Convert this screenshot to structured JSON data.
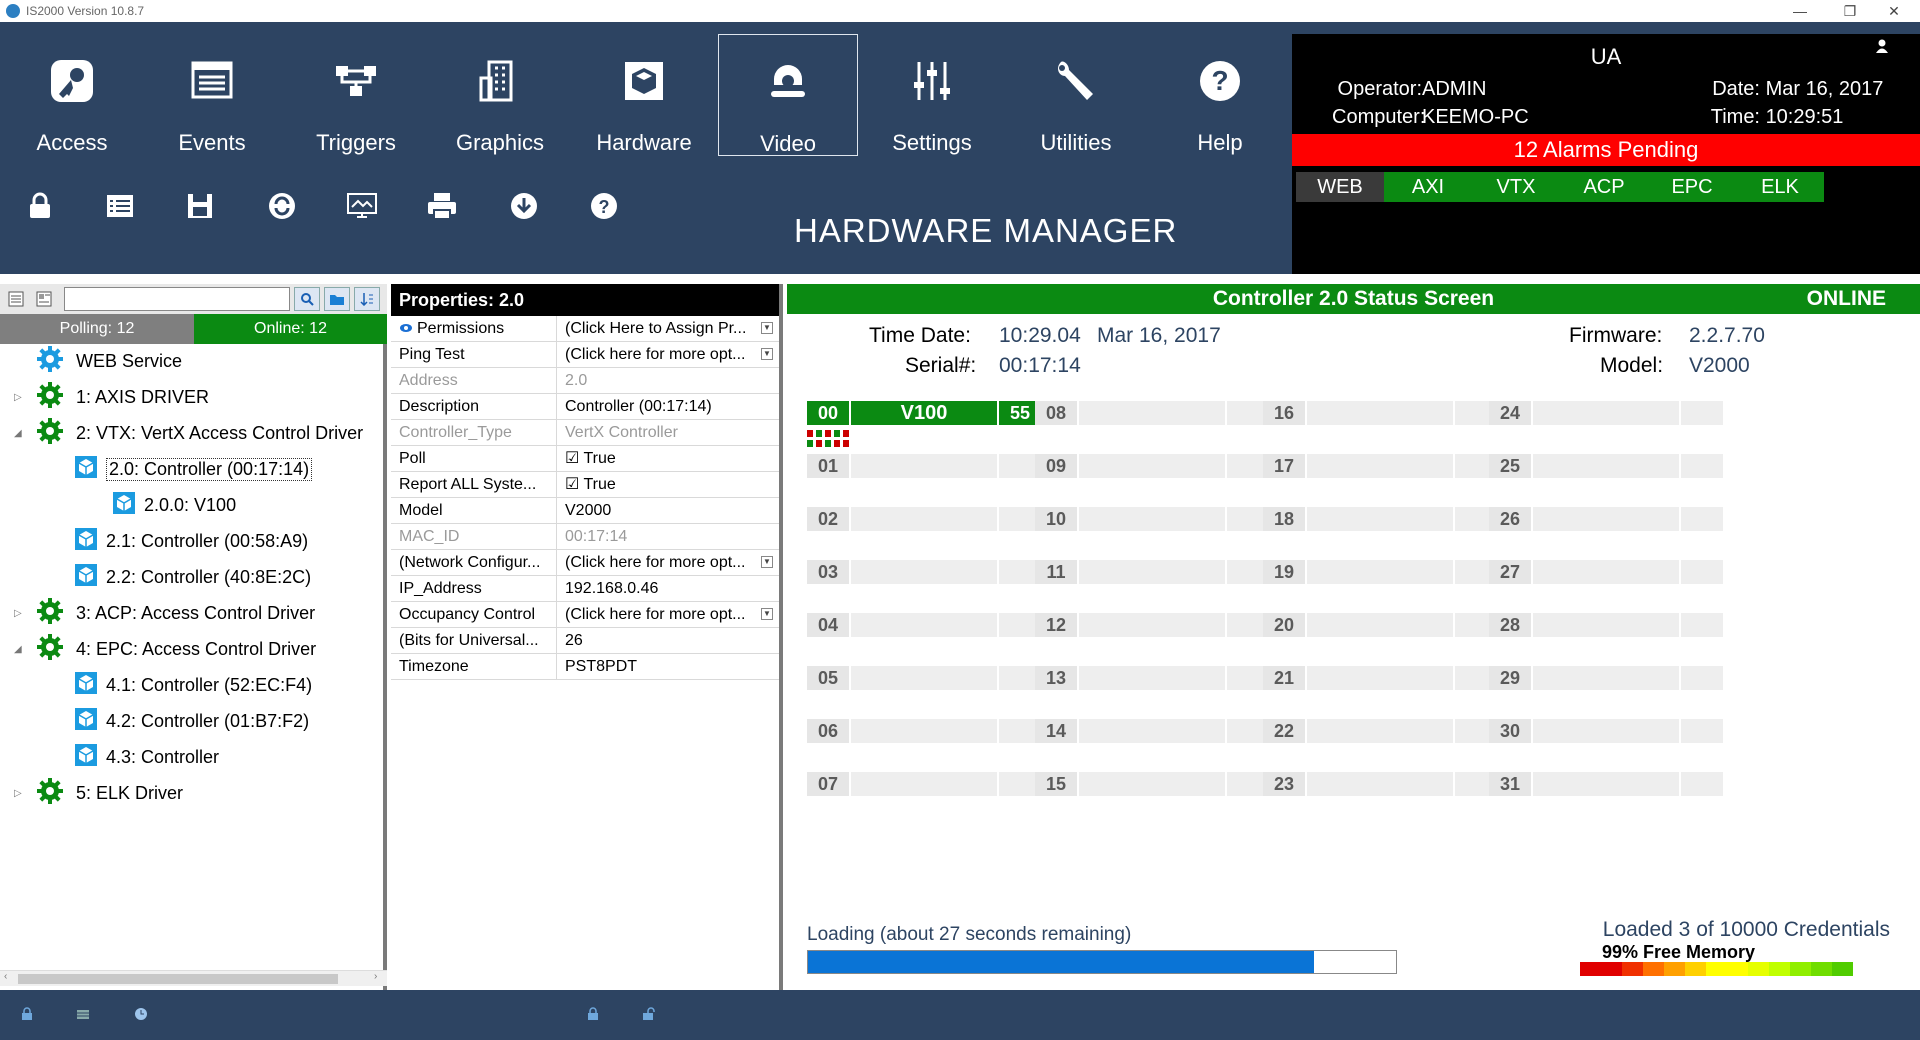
{
  "window": {
    "title": "IS2000 Version 10.8.7"
  },
  "nav": [
    {
      "label": "Access",
      "icon": "access-icon"
    },
    {
      "label": "Events",
      "icon": "events-icon"
    },
    {
      "label": "Triggers",
      "icon": "triggers-icon"
    },
    {
      "label": "Graphics",
      "icon": "graphics-icon"
    },
    {
      "label": "Hardware",
      "icon": "hardware-icon"
    },
    {
      "label": "Video",
      "icon": "video-icon",
      "active": true
    },
    {
      "label": "Settings",
      "icon": "settings-icon"
    },
    {
      "label": "Utilities",
      "icon": "utilities-icon"
    },
    {
      "label": "Help",
      "icon": "help-icon"
    }
  ],
  "toolbar": [
    "lock-icon",
    "list-icon",
    "save-icon",
    "refresh-icon",
    "monitor-icon",
    "print-icon",
    "download-icon",
    "help-icon"
  ],
  "page_title": "HARDWARE MANAGER",
  "status": {
    "ua": "UA",
    "operator_label": "Operator:",
    "operator": "ADMIN",
    "computer_label": "Computer:",
    "computer": "KEEMO-PC",
    "date_label": "Date:",
    "date": "Mar 16, 2017",
    "time_label": "Time:",
    "time": "10:29:51",
    "alarms": "12 Alarms Pending",
    "drivers": [
      {
        "name": "WEB",
        "color": "#3a3a3a"
      },
      {
        "name": "AXI",
        "color": "#0b8a12"
      },
      {
        "name": "VTX",
        "color": "#0b8a12"
      },
      {
        "name": "ACP",
        "color": "#0b8a12"
      },
      {
        "name": "EPC",
        "color": "#0b8a12"
      },
      {
        "name": "ELK",
        "color": "#0b8a12"
      }
    ]
  },
  "left": {
    "polling": "Polling:  12",
    "online": "Online:  12",
    "tree": [
      {
        "id": "web",
        "label": "WEB Service",
        "icon": "gear-blue"
      },
      {
        "id": "axis",
        "label": "1:  AXIS DRIVER",
        "icon": "gear-green"
      },
      {
        "id": "vtx",
        "label": "2:  VTX: VertX Access Control Driver",
        "icon": "gear-green"
      },
      {
        "id": "c20",
        "label": "2.0:  Controller (00:17:14)",
        "icon": "cube",
        "selected": true
      },
      {
        "id": "c200",
        "label": "2.0.0:  V100",
        "icon": "cube"
      },
      {
        "id": "c21",
        "label": "2.1:  Controller (00:58:A9)",
        "icon": "cube"
      },
      {
        "id": "c22",
        "label": "2.2:  Controller (40:8E:2C)",
        "icon": "cube"
      },
      {
        "id": "acp",
        "label": "3:  ACP: Access Control Driver",
        "icon": "gear-green"
      },
      {
        "id": "epc",
        "label": "4:  EPC: Access Control Driver",
        "icon": "gear-green"
      },
      {
        "id": "c41",
        "label": "4.1:  Controller (52:EC:F4)",
        "icon": "cube"
      },
      {
        "id": "c42",
        "label": "4.2:  Controller (01:B7:F2)",
        "icon": "cube"
      },
      {
        "id": "c43",
        "label": "4.3:  Controller",
        "icon": "cube"
      },
      {
        "id": "elk",
        "label": "5:  ELK Driver",
        "icon": "gear-green"
      }
    ]
  },
  "properties": {
    "title": "Properties:  2.0",
    "rows": [
      {
        "k": "Permissions",
        "v": "(Click Here to Assign Pr...",
        "dd": true,
        "eye": true
      },
      {
        "k": "Ping Test",
        "v": "(Click here for more opt...",
        "dd": true
      },
      {
        "k": "Address",
        "v": "2.0",
        "gray": true
      },
      {
        "k": "Description",
        "v": "Controller (00:17:14)"
      },
      {
        "k": "Controller_Type",
        "v": "VertX Controller",
        "gray": true
      },
      {
        "k": "Poll",
        "v": "☑ True"
      },
      {
        "k": "Report ALL Syste...",
        "v": "☑ True"
      },
      {
        "k": "Model",
        "v": "V2000"
      },
      {
        "k": "MAC_ID",
        "v": "00:17:14",
        "gray": true
      },
      {
        "k": "(Network Configur...",
        "v": "(Click here for more opt...",
        "dd": true
      },
      {
        "k": "IP_Address",
        "v": "192.168.0.46"
      },
      {
        "k": "Occupancy Control",
        "v": "(Click here for more opt...",
        "dd": true
      },
      {
        "k": "(Bits for Universal...",
        "v": "26"
      },
      {
        "k": "Timezone",
        "v": "PST8PDT"
      }
    ]
  },
  "controller": {
    "title": "Controller 2.0 Status Screen",
    "state": "ONLINE",
    "time_date_label": "Time Date:",
    "time": "10:29.04",
    "date": "Mar 16, 2017",
    "serial_label": "Serial#:",
    "serial": "00:17:14",
    "firmware_label": "Firmware:",
    "firmware": "2.2.7.70",
    "model_label": "Model:",
    "model": "V2000",
    "device0": {
      "num": "00",
      "name": "V100",
      "count": "55"
    },
    "devices": [
      "01",
      "02",
      "03",
      "04",
      "05",
      "06",
      "07",
      "08",
      "09",
      "10",
      "11",
      "12",
      "13",
      "14",
      "15",
      "16",
      "17",
      "18",
      "19",
      "20",
      "21",
      "22",
      "23",
      "24",
      "25",
      "26",
      "27",
      "28",
      "29",
      "30",
      "31"
    ],
    "loading": "Loading (about 27 seconds remaining)",
    "progress": 0.86,
    "credentials": "Loaded 3 of 10000 Credentials",
    "memory": "99% Free Memory",
    "memory_colors": [
      "#e00000",
      "#e00000",
      "#f03000",
      "#ff7000",
      "#ffa000",
      "#ffd000",
      "#ffff00",
      "#ffff00",
      "#e6ff00",
      "#c0ff00",
      "#90ee00",
      "#70dd00",
      "#50cc00"
    ]
  }
}
